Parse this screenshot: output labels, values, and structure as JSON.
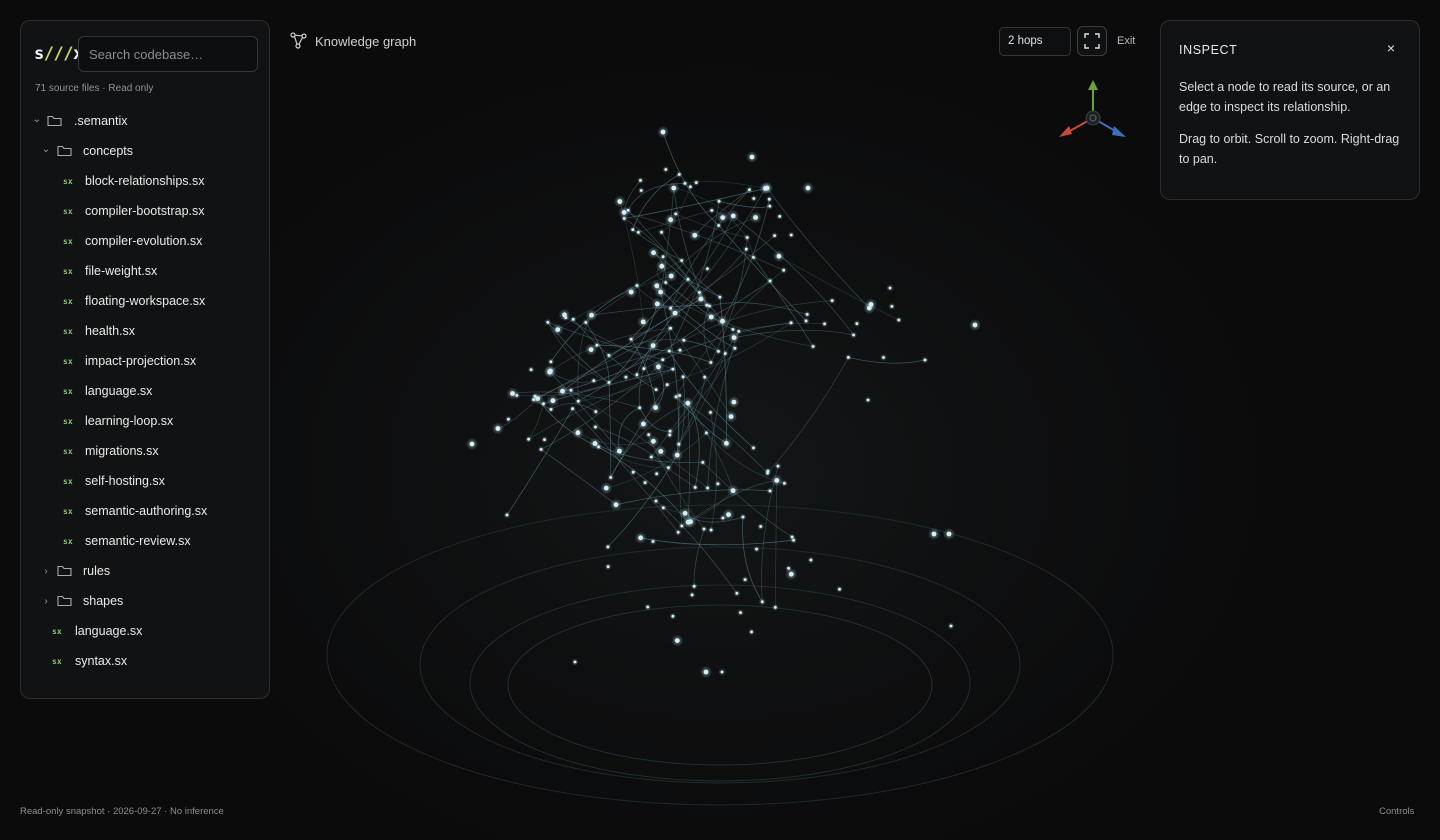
{
  "sidebar": {
    "logo": {
      "prefix": "s",
      "slashes": "///",
      "suffix": "x"
    },
    "search": {
      "placeholder": "Search codebase…",
      "value": ""
    },
    "meta": "71 source files · Read only",
    "tree": [
      {
        "type": "folder",
        "label": ".semantix",
        "depth": 0,
        "expanded": true
      },
      {
        "type": "folder",
        "label": "concepts",
        "depth": 1,
        "expanded": true
      },
      {
        "type": "file",
        "label": "block-relationships.sx",
        "depth": 2
      },
      {
        "type": "file",
        "label": "compiler-bootstrap.sx",
        "depth": 2
      },
      {
        "type": "file",
        "label": "compiler-evolution.sx",
        "depth": 2
      },
      {
        "type": "file",
        "label": "file-weight.sx",
        "depth": 2
      },
      {
        "type": "file",
        "label": "floating-workspace.sx",
        "depth": 2
      },
      {
        "type": "file",
        "label": "health.sx",
        "depth": 2
      },
      {
        "type": "file",
        "label": "impact-projection.sx",
        "depth": 2
      },
      {
        "type": "file",
        "label": "language.sx",
        "depth": 2
      },
      {
        "type": "file",
        "label": "learning-loop.sx",
        "depth": 2
      },
      {
        "type": "file",
        "label": "migrations.sx",
        "depth": 2
      },
      {
        "type": "file",
        "label": "self-hosting.sx",
        "depth": 2
      },
      {
        "type": "file",
        "label": "semantic-authoring.sx",
        "depth": 2
      },
      {
        "type": "file",
        "label": "semantic-review.sx",
        "depth": 2
      },
      {
        "type": "folder",
        "label": "rules",
        "depth": 1,
        "expanded": false
      },
      {
        "type": "folder",
        "label": "shapes",
        "depth": 1,
        "expanded": false
      },
      {
        "type": "file",
        "label": "language.sx",
        "depth": 1
      },
      {
        "type": "file",
        "label": "syntax.sx",
        "depth": 1
      }
    ],
    "file_tag": "sx"
  },
  "header": {
    "title": "Knowledge graph",
    "hops": "2 hops",
    "exit": "Exit",
    "graph_icon": "graph-nodes-icon",
    "fullscreen_icon": "fullscreen-icon"
  },
  "inspect": {
    "title": "INSPECT",
    "close": "×",
    "text1": "Select a node to read its source, or an edge to inspect its relationship.",
    "text2": "Drag to orbit. Scroll to zoom. Right-drag to pan."
  },
  "gizmo": {
    "x_color": "#c94a3a",
    "y_color": "#6aa13a",
    "z_color": "#3d6fb8"
  },
  "footer": {
    "left": "Read-only snapshot · 2026-09-27 · No inference",
    "right": "Controls"
  },
  "colors": {
    "node": "#d4f0f6",
    "edge": "#5f8a93",
    "accent": "#c9d96a"
  }
}
